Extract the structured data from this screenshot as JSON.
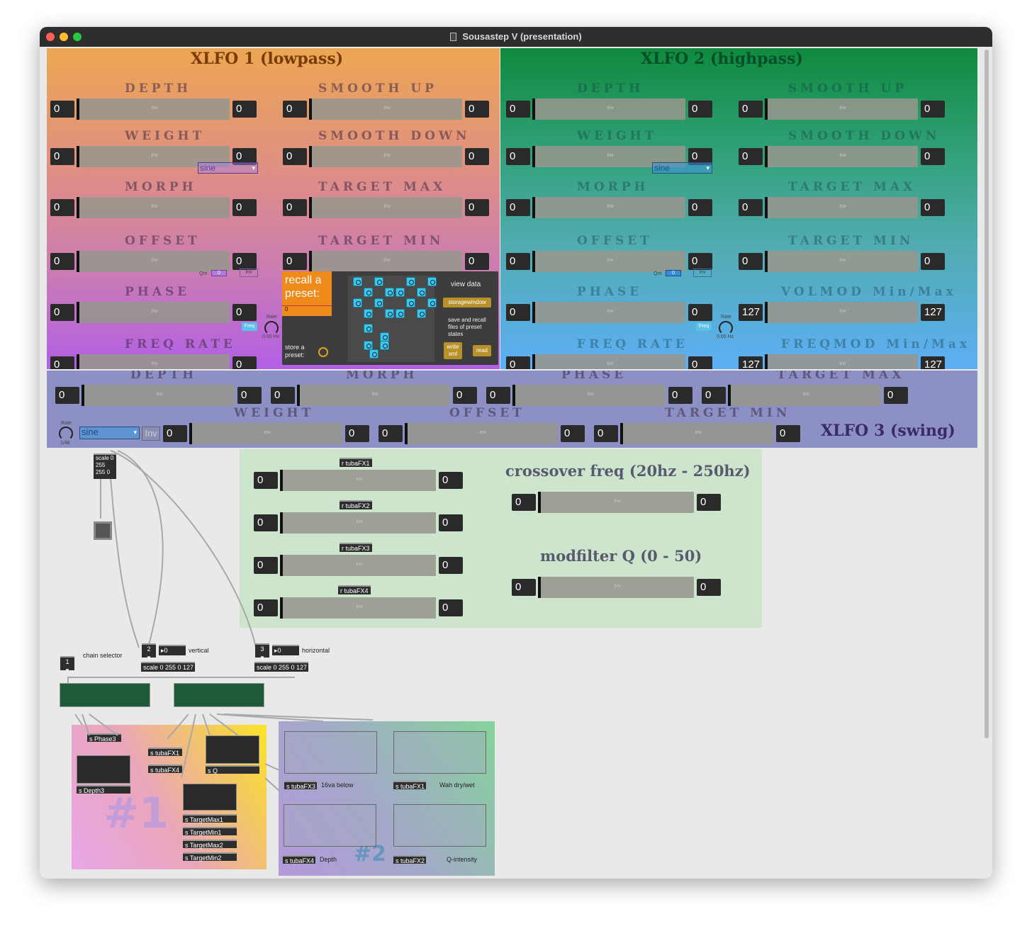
{
  "window": {
    "title": "Sousastep V (presentation)"
  },
  "xlfo1": {
    "title": "XLFO 1 (lowpass)",
    "morph_menu": "sine",
    "qnt": "Qnt",
    "qnt_val": "0",
    "inv": "Inv",
    "rate": "Rate",
    "hz": "0.00 Hz",
    "freq": "Freq",
    "left_labels": [
      "DEPTH",
      "WEIGHT",
      "MORPH",
      "OFFSET",
      "PHASE",
      "FREQ RATE"
    ],
    "right_labels": [
      "SMOOTH UP",
      "SMOOTH DOWN",
      "TARGET MAX",
      "TARGET MIN"
    ],
    "value": "0"
  },
  "xlfo2": {
    "title": "XLFO 2 (highpass)",
    "morph_menu": "sine",
    "qnt": "Qnt",
    "qnt_val": "0",
    "inv": "Inv",
    "rate": "Rate",
    "hz": "0.00 Hz",
    "freq": "Freq",
    "left_labels": [
      "DEPTH",
      "WEIGHT",
      "MORPH",
      "OFFSET",
      "PHASE",
      "FREQ RATE"
    ],
    "right_labels": [
      "SMOOTH UP",
      "SMOOTH DOWN",
      "TARGET MAX",
      "TARGET MIN",
      "VOLMOD Min/Max",
      "FREQMOD Min/Max"
    ],
    "value": "0",
    "value_127": "127"
  },
  "xlfo3": {
    "title": "XLFO 3 (swing)",
    "labels_top": [
      "DEPTH",
      "MORPH",
      "PHASE",
      "TARGET MAX"
    ],
    "labels_bottom": [
      "WEIGHT",
      "OFFSET",
      "TARGET MIN"
    ],
    "rate": "Rate",
    "rate_val": "1/48",
    "menu": "sine",
    "inv": "Inv",
    "value": "0"
  },
  "preset": {
    "recall": "recall a preset:",
    "recall_val": "0",
    "store": "store a preset:",
    "view_data": "view data",
    "storagewindow": "storagewindow",
    "save_recall": "save and recall files of preset states",
    "write": "write xml",
    "read": "read"
  },
  "mid_panel": {
    "receivers": [
      "r tubaFX1",
      "r tubaFX2",
      "r tubaFX3",
      "r tubaFX4"
    ],
    "crossover": "crossover freq (20hz - 250hz)",
    "modfilter": "modfilter Q (0 - 50)",
    "value": "0"
  },
  "patch": {
    "scale_top": "scale 0 255 255 0",
    "chain_selector": "chain selector",
    "vertical": "vertical",
    "horizontal": "horizontal",
    "scale_obj": "scale 0 255 0 127",
    "msg1": "1",
    "msg2": "2",
    "msg3": "3",
    "num0": "0"
  },
  "chain1": {
    "sends": [
      "s Phase3",
      "s Depth3",
      "s tubaFX1",
      "s tubaFX4",
      "s Q",
      "s TargetMax1",
      "s TargetMin1",
      "s TargetMax2",
      "s TargetMin2"
    ],
    "big": "#1"
  },
  "chain2": {
    "sends": [
      "s tubaFX3",
      "s tubaFX1",
      "s tubaFX4",
      "s tubaFX2"
    ],
    "labels": [
      "16va below",
      "Wah dry/wet",
      "Depth",
      "Q-intensity"
    ],
    "big": "#2"
  },
  "colors": {
    "xlfo1_top": "#eda652",
    "xlfo1_bottom": "#b15fe6",
    "xlfo2_top": "#0f8a3d",
    "xlfo2_bottom": "#5daff5",
    "xlfo3": "#8c90c4",
    "mid": "#cde5cd"
  }
}
